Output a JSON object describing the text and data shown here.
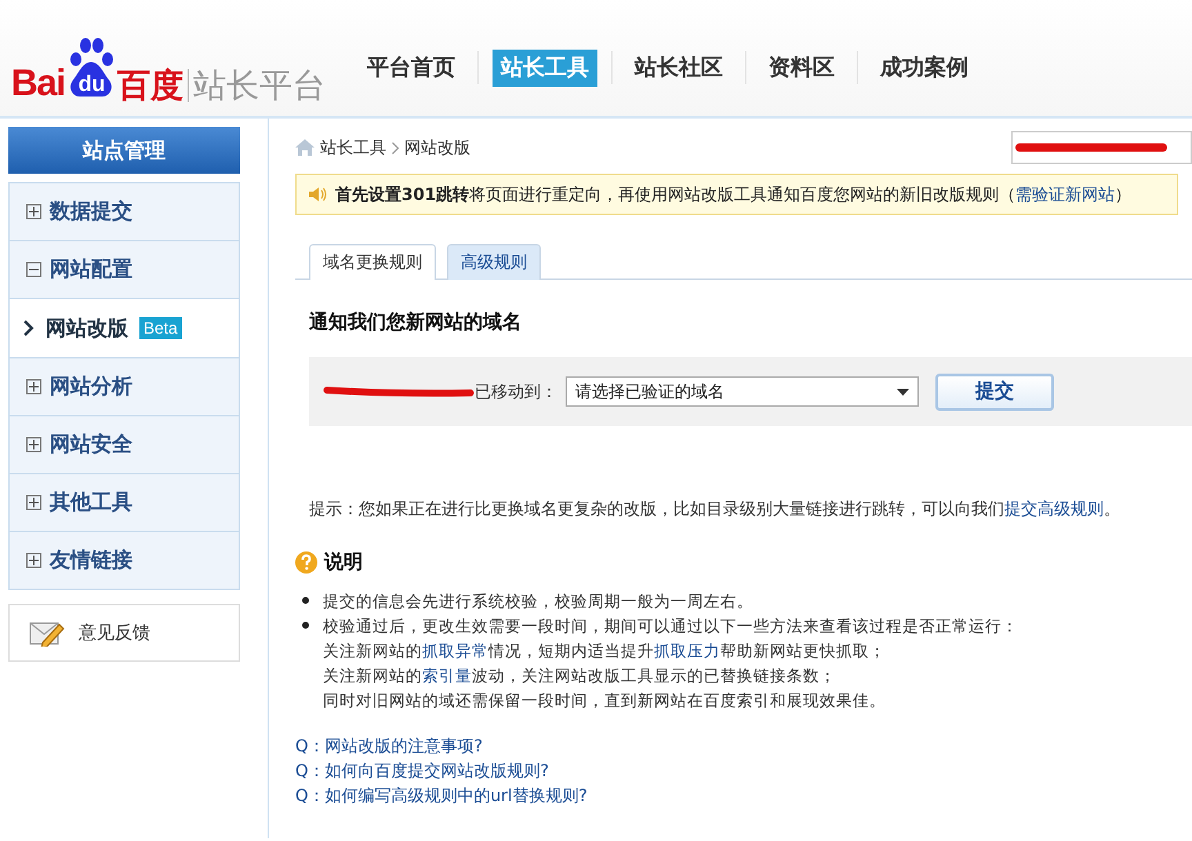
{
  "logo": {
    "brand_left": "Bai",
    "paw_text": "du",
    "brand_cn": "百度",
    "product": "站长平台"
  },
  "nav": [
    {
      "label": "平台首页",
      "selected": false
    },
    {
      "label": "站长工具",
      "selected": true
    },
    {
      "label": "站长社区",
      "selected": false
    },
    {
      "label": "资料区",
      "selected": false
    },
    {
      "label": "成功案例",
      "selected": false
    }
  ],
  "sidebar": {
    "title": "站点管理",
    "items": [
      {
        "label": "数据提交",
        "expanded": false
      },
      {
        "label": "网站配置",
        "expanded": true,
        "children": [
          {
            "label": "网站改版",
            "badge": "Beta",
            "selected": true
          }
        ]
      },
      {
        "label": "网站分析",
        "expanded": false
      },
      {
        "label": "网站安全",
        "expanded": false
      },
      {
        "label": "其他工具",
        "expanded": false
      },
      {
        "label": "友情链接",
        "expanded": false
      }
    ],
    "feedback": "意见反馈"
  },
  "breadcrumb": [
    "站长工具",
    "网站改版"
  ],
  "notice": {
    "text": "**首先设置301跳转**将页面进行重定向，再使用网站改版工具通知百度您网站的新旧改版规则（",
    "link": "需验证新网站",
    "after": "）"
  },
  "tabs": [
    {
      "label": "域名更换规则",
      "selected": true
    },
    {
      "label": "高级规则",
      "selected": false
    }
  ],
  "form": {
    "heading": "通知我们您新网站的域名",
    "moved_label": "已移动到：",
    "select_value": "请选择已验证的域名",
    "submit": "提交"
  },
  "tip": {
    "text": "提示：您如果正在进行比更换域名更复杂的改版，比如目录级别大量链接进行跳转，可以向我们",
    "link": "提交高级规则",
    "after": "。"
  },
  "explain": {
    "title": "说明",
    "bullets": [
      {
        "lines": [
          [
            {
              "kind": "text",
              "text": "提交的信息会先进行系统校验，校验周期一般为一周左右。"
            }
          ]
        ]
      },
      {
        "lines": [
          [
            {
              "kind": "text",
              "text": "校验通过后，更改生效需要一段时间，期间可以通过以下一些方法来查看该过程是否正常运行："
            }
          ],
          [
            {
              "kind": "text",
              "text": "关注新网站的"
            },
            {
              "kind": "link",
              "text": "抓取异常"
            },
            {
              "kind": "text",
              "text": "情况，短期内适当提升"
            },
            {
              "kind": "link",
              "text": "抓取压力"
            },
            {
              "kind": "text",
              "text": "帮助新网站更快抓取；"
            }
          ],
          [
            {
              "kind": "text",
              "text": "关注新网站的"
            },
            {
              "kind": "link",
              "text": "索引量"
            },
            {
              "kind": "text",
              "text": "波动，关注网站改版工具显示的已替换链接条数；"
            }
          ],
          [
            {
              "kind": "text",
              "text": "同时对旧网站的域还需保留一段时间，直到新网站在百度索引和展现效果佳。"
            }
          ]
        ]
      }
    ]
  },
  "faq": [
    {
      "prefix": "Q：",
      "question": "网站改版的注意事项?"
    },
    {
      "prefix": "Q：",
      "question": "如何向百度提交网站改版规则?"
    },
    {
      "prefix": "Q：",
      "question": "如何编写高级规则中的url替换规则?"
    }
  ]
}
